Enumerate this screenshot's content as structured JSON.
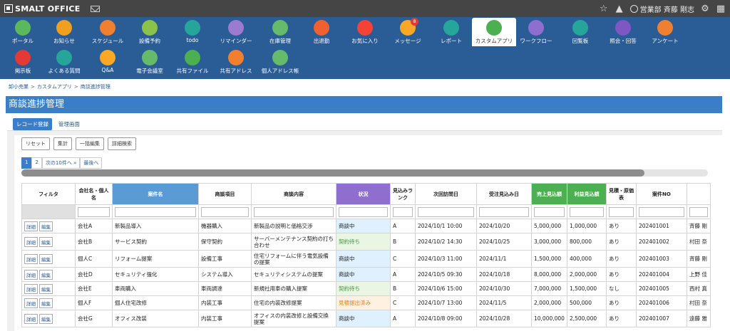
{
  "app": {
    "logo_text": "SMALT OFFICE",
    "user_name": "営業部 斉藤 剛志"
  },
  "nav": [
    {
      "label": "ポータル",
      "icon": "home-icon",
      "color": "#5cb85c"
    },
    {
      "label": "お知らせ",
      "icon": "megaphone-icon",
      "color": "#f0a020"
    },
    {
      "label": "スケジュール",
      "icon": "calendar-icon",
      "color": "#f08030"
    },
    {
      "label": "設備予約",
      "icon": "facility-icon",
      "color": "#8bc34a"
    },
    {
      "label": "todo",
      "icon": "check-icon",
      "color": "#26a69a"
    },
    {
      "label": "リマインダー",
      "icon": "bell-icon",
      "color": "#9c7ad0"
    },
    {
      "label": "在庫管理",
      "icon": "box-icon",
      "color": "#66bb6a"
    },
    {
      "label": "出退勤",
      "icon": "clock-icon",
      "color": "#f06030"
    },
    {
      "label": "お気に入り",
      "icon": "star-icon",
      "color": "#f44336"
    },
    {
      "label": "メッセージ",
      "icon": "message-icon",
      "color": "#f9a825",
      "badge": "8"
    },
    {
      "label": "レポート",
      "icon": "report-icon",
      "color": "#26a69a"
    },
    {
      "label": "カスタムアプリ",
      "icon": "custom-app-icon",
      "color": "#4caf50"
    },
    {
      "label": "ワークフロー",
      "icon": "workflow-icon",
      "color": "#8e6fcf"
    },
    {
      "label": "回覧板",
      "icon": "circular-icon",
      "color": "#26a69a"
    },
    {
      "label": "照会・回答",
      "icon": "inquiry-icon",
      "color": "#7e57c2"
    },
    {
      "label": "アンケート",
      "icon": "survey-icon",
      "color": "#f08030"
    },
    {
      "label": "掲示板",
      "icon": "board-icon",
      "color": "#e53935"
    },
    {
      "label": "よくある質問",
      "icon": "faq-icon",
      "color": "#26a69a"
    },
    {
      "label": "Q&A",
      "icon": "qa-icon",
      "color": "#f9a825"
    },
    {
      "label": "電子会議室",
      "icon": "meeting-icon",
      "color": "#66bb6a"
    },
    {
      "label": "共有ファイル",
      "icon": "file-icon",
      "color": "#4caf50"
    },
    {
      "label": "共有アドレス",
      "icon": "address-icon",
      "color": "#f08030"
    },
    {
      "label": "個人アドレス帳",
      "icon": "contact-icon",
      "color": "#66bb6a"
    }
  ],
  "breadcrumb": [
    "卸小売業",
    "カスタムアプリ",
    "商談進捗管理"
  ],
  "page_title": "商談進捗管理",
  "tabs": {
    "record": "レコード登録",
    "manage": "管理画面"
  },
  "toolbar": {
    "reset": "リセット",
    "aggregate": "集計",
    "bulk_edit": "一括編集",
    "detail_search": "詳細検索"
  },
  "pager": {
    "p1": "1",
    "p2": "2",
    "next": "次の10件へ »",
    "last": "最後へ"
  },
  "table": {
    "headers": [
      "フィルタ",
      "会社名・個人名",
      "案件名",
      "商談項目",
      "商談内容",
      "状況",
      "見込みランク",
      "次回訪問日",
      "受注見込み日",
      "売上見込額",
      "利益見込額",
      "見積・原価表",
      "案件NO",
      ""
    ],
    "detail_btn": "詳細",
    "edit_btn": "編集",
    "rows": [
      {
        "company": "会社A",
        "case": "新製品導入",
        "item": "機器購入",
        "content": "新製品の説明と価格交渉",
        "status": "商談中",
        "rank": "A",
        "next": "2024/10/1 10:00",
        "order": "2024/10/20",
        "sales": "5,000,000",
        "profit": "1,000,000",
        "quote": "あり",
        "no": "202401001",
        "owner": "斉藤 剛"
      },
      {
        "company": "会社B",
        "case": "サービス契約",
        "item": "保守契約",
        "content": "サーバーメンテナンス契約の打ち合わせ",
        "status": "契約待ち",
        "rank": "B",
        "next": "2024/10/2 14:30",
        "order": "2024/10/25",
        "sales": "3,000,000",
        "profit": "800,000",
        "quote": "あり",
        "no": "202401002",
        "owner": "村田 奈"
      },
      {
        "company": "個人C",
        "case": "リフォーム提案",
        "item": "設備工事",
        "content": "住宅リフォームに伴う電気設備の提案",
        "status": "商談中",
        "rank": "C",
        "next": "2024/10/3 11:00",
        "order": "2024/11/1",
        "sales": "1,500,000",
        "profit": "400,000",
        "quote": "あり",
        "no": "202401003",
        "owner": "斉藤 剛"
      },
      {
        "company": "会社D",
        "case": "セキュリティ強化",
        "item": "システム導入",
        "content": "セキュリティシステムの提案",
        "status": "商談中",
        "rank": "A",
        "next": "2024/10/5 09:30",
        "order": "2024/10/18",
        "sales": "8,000,000",
        "profit": "2,000,000",
        "quote": "あり",
        "no": "202401004",
        "owner": "上野 佳"
      },
      {
        "company": "会社E",
        "case": "車両購入",
        "item": "車両調達",
        "content": "新規社用車の購入提案",
        "status": "契約待ち",
        "rank": "B",
        "next": "2024/10/6 15:00",
        "order": "2024/10/30",
        "sales": "7,000,000",
        "profit": "1,500,000",
        "quote": "なし",
        "no": "202401005",
        "owner": "西村 真"
      },
      {
        "company": "個人F",
        "case": "個人住宅改修",
        "item": "内装工事",
        "content": "住宅の内装改修提案",
        "status": "見積提出済み",
        "rank": "C",
        "next": "2024/10/7 13:00",
        "order": "2024/11/5",
        "sales": "2,000,000",
        "profit": "500,000",
        "quote": "あり",
        "no": "202401006",
        "owner": "村田 奈"
      },
      {
        "company": "会社G",
        "case": "オフィス改装",
        "item": "内装工事",
        "content": "オフィスの内装改修と設備交換提案",
        "status": "商談中",
        "rank": "A",
        "next": "2024/10/8 09:00",
        "order": "2024/10/28",
        "sales": "10,000,000",
        "profit": "2,500,000",
        "quote": "あり",
        "no": "202401007",
        "owner": "遠藤 雅"
      }
    ]
  }
}
